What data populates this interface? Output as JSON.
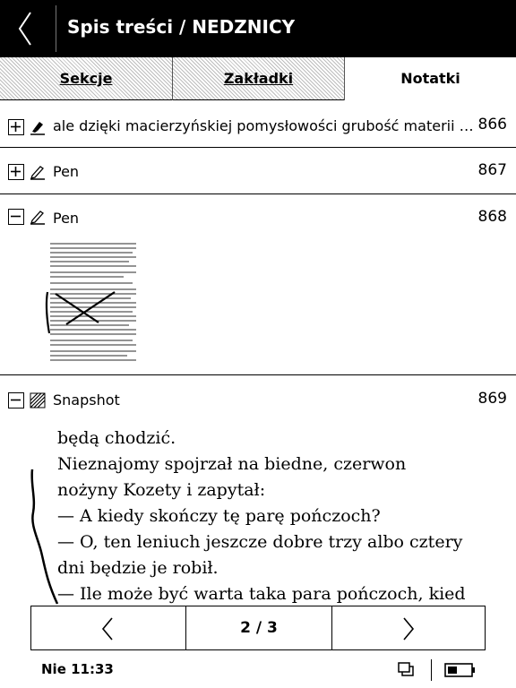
{
  "header": {
    "title": "Spis treści / NEDZNICY"
  },
  "tabs": [
    {
      "label": "Sekcje",
      "active": false
    },
    {
      "label": "Zakładki",
      "active": false
    },
    {
      "label": "Notatki",
      "active": true
    }
  ],
  "notes": [
    {
      "expander": "plus",
      "type_icon": "marker-icon",
      "text": "ale dzięki macierzyńskiej pomysłowości grubość materii grubość materii",
      "page": "866"
    },
    {
      "expander": "plus",
      "type_icon": "pen-icon",
      "text": "Pen",
      "page": "867"
    },
    {
      "expander": "minus",
      "type_icon": "pen-icon",
      "text": "Pen",
      "page": "868"
    },
    {
      "expander": "minus",
      "type_icon": "snapshot-icon",
      "text": "Snapshot",
      "page": "869"
    }
  ],
  "snapshot_lines": [
    "będą chodzić.",
    "Nieznajomy spojrzał na biedne, czerwon",
    "nożyny Kozety i zapytał:",
    "— A kiedy skończy tę parę pończoch?",
    "— O, ten leniuch jeszcze dobre trzy albo cztery",
    "dni będzie je robił.",
    "— Ile może być warta taka para pończoch, kied"
  ],
  "pager": {
    "label": "2 / 3"
  },
  "status": {
    "time": "Nie 11:33",
    "battery_level": 0.4
  },
  "colors": {
    "header_bg": "#000000",
    "text": "#000000",
    "background": "#ffffff"
  }
}
